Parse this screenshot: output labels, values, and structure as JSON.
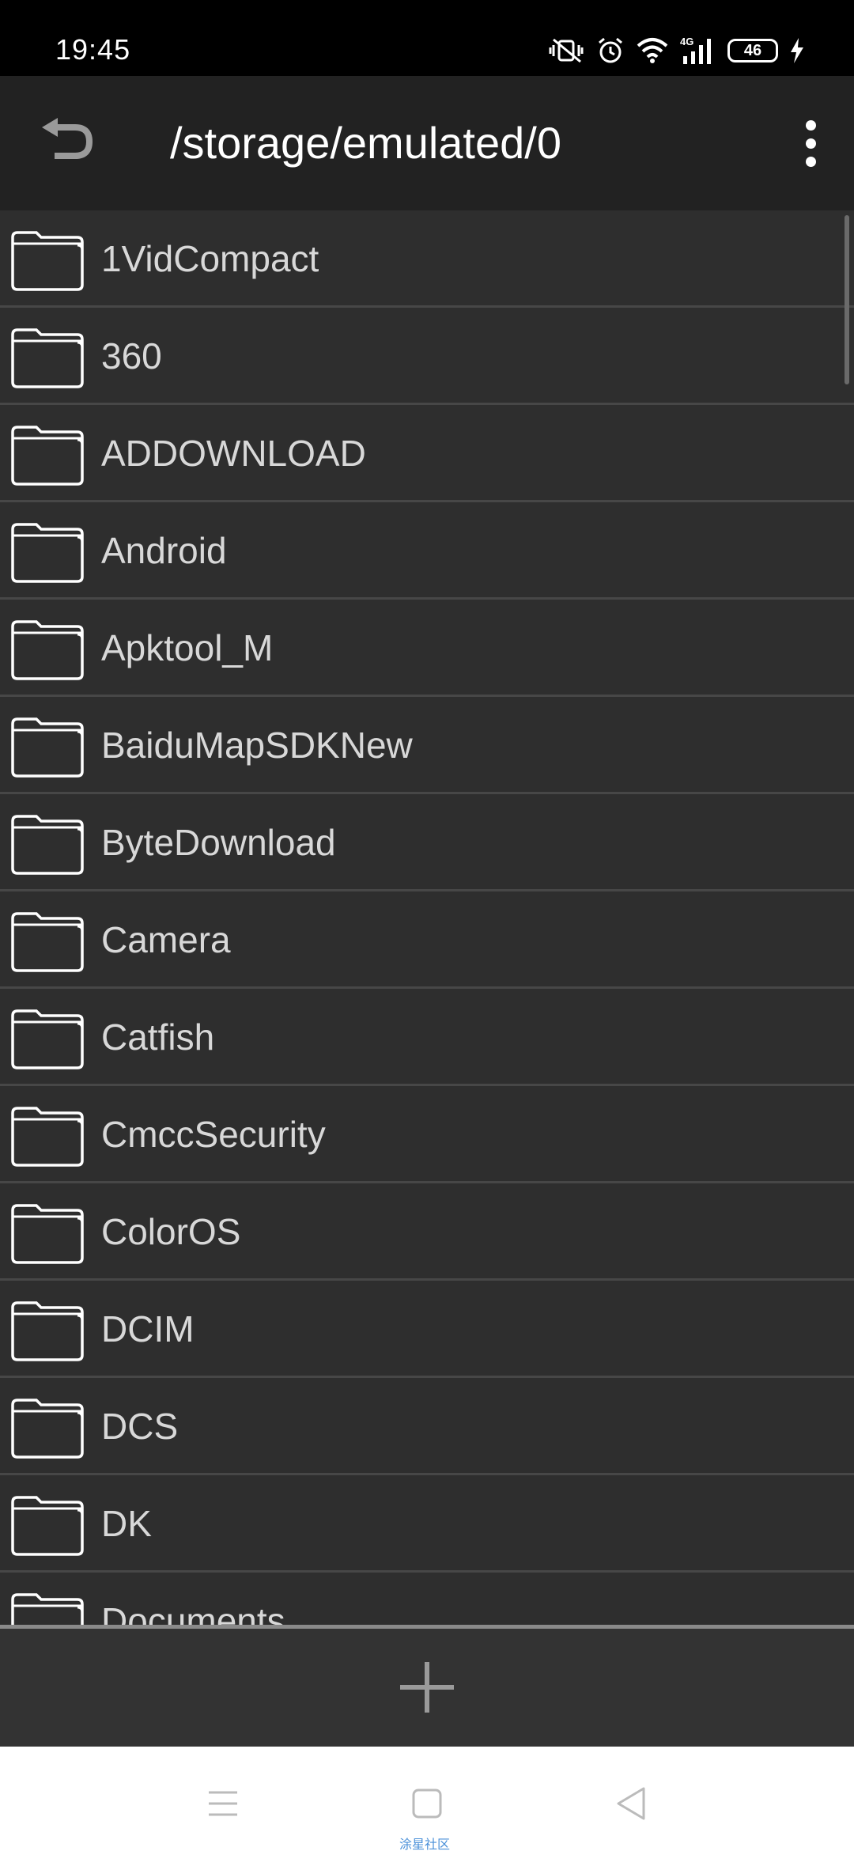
{
  "status_bar": {
    "time": "19:45",
    "network": "4G",
    "battery": "46",
    "icons": [
      "vibrate-mute-icon",
      "alarm-icon",
      "wifi-icon",
      "signal-4g-icon",
      "battery-icon",
      "charging-icon"
    ]
  },
  "app_bar": {
    "title": "/storage/emulated/0",
    "back_icon": "undo-arrow-icon",
    "menu_icon": "overflow-menu-icon"
  },
  "files": [
    {
      "name": "1VidCompact",
      "icon": "folder-icon"
    },
    {
      "name": "360",
      "icon": "folder-icon"
    },
    {
      "name": "ADDOWNLOAD",
      "icon": "folder-icon"
    },
    {
      "name": "Android",
      "icon": "folder-icon"
    },
    {
      "name": "Apktool_M",
      "icon": "folder-icon"
    },
    {
      "name": "BaiduMapSDKNew",
      "icon": "folder-icon"
    },
    {
      "name": "ByteDownload",
      "icon": "folder-icon"
    },
    {
      "name": "Camera",
      "icon": "folder-icon"
    },
    {
      "name": "Catfish",
      "icon": "folder-icon"
    },
    {
      "name": "CmccSecurity",
      "icon": "folder-icon"
    },
    {
      "name": "ColorOS",
      "icon": "folder-icon"
    },
    {
      "name": "DCIM",
      "icon": "folder-icon"
    },
    {
      "name": "DCS",
      "icon": "folder-icon"
    },
    {
      "name": "DK",
      "icon": "folder-icon"
    },
    {
      "name": "Documents",
      "icon": "folder-icon"
    }
  ],
  "bottom_bar": {
    "add_icon": "plus-icon"
  },
  "system_nav": {
    "buttons": [
      "menu-icon",
      "home-icon",
      "back-icon"
    ],
    "watermark": "涂星社区"
  },
  "colors": {
    "status_bar_bg": "#000000",
    "app_bar_bg": "#222222",
    "list_bg": "#2e2e2e",
    "divider": "#474747",
    "text": "#d8d8d8",
    "nav_bg": "#ffffff",
    "watermark": "#4a90d9"
  }
}
